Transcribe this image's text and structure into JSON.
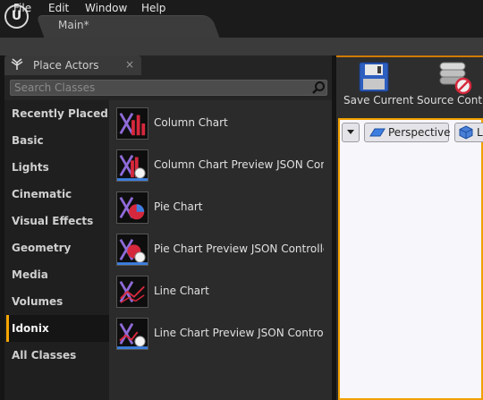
{
  "window": {
    "logo_text": "U",
    "tab_title": "Main*"
  },
  "menubar": {
    "items": [
      "File",
      "Edit",
      "Window",
      "Help"
    ]
  },
  "panel": {
    "tab_label": "Place Actors",
    "close_glyph": "×"
  },
  "search": {
    "placeholder": "Search Classes"
  },
  "categories": [
    "Recently Placed",
    "Basic",
    "Lights",
    "Cinematic",
    "Visual Effects",
    "Geometry",
    "Media",
    "Volumes",
    "Idonix",
    "All Classes"
  ],
  "selected_category": "Idonix",
  "items": [
    {
      "label": "Column Chart",
      "icon": "column-chart-icon"
    },
    {
      "label": "Column Chart Preview JSON Con",
      "icon": "column-chart-preview-icon"
    },
    {
      "label": "Pie Chart",
      "icon": "pie-chart-icon"
    },
    {
      "label": "Pie Chart Preview JSON Controlle",
      "icon": "pie-chart-preview-icon"
    },
    {
      "label": "Line Chart",
      "icon": "line-chart-icon"
    },
    {
      "label": "Line Chart Preview JSON Control",
      "icon": "line-chart-preview-icon"
    }
  ],
  "toolbar": {
    "save_label": "Save Current",
    "source_label": "Source Control"
  },
  "viewport": {
    "perspective_label": "Perspective",
    "lit_label": "L"
  },
  "colors": {
    "accent": "#f6a500",
    "item_red": "#d6283c",
    "item_blue": "#3d7fe0",
    "item_purple": "#8f6bd8"
  }
}
